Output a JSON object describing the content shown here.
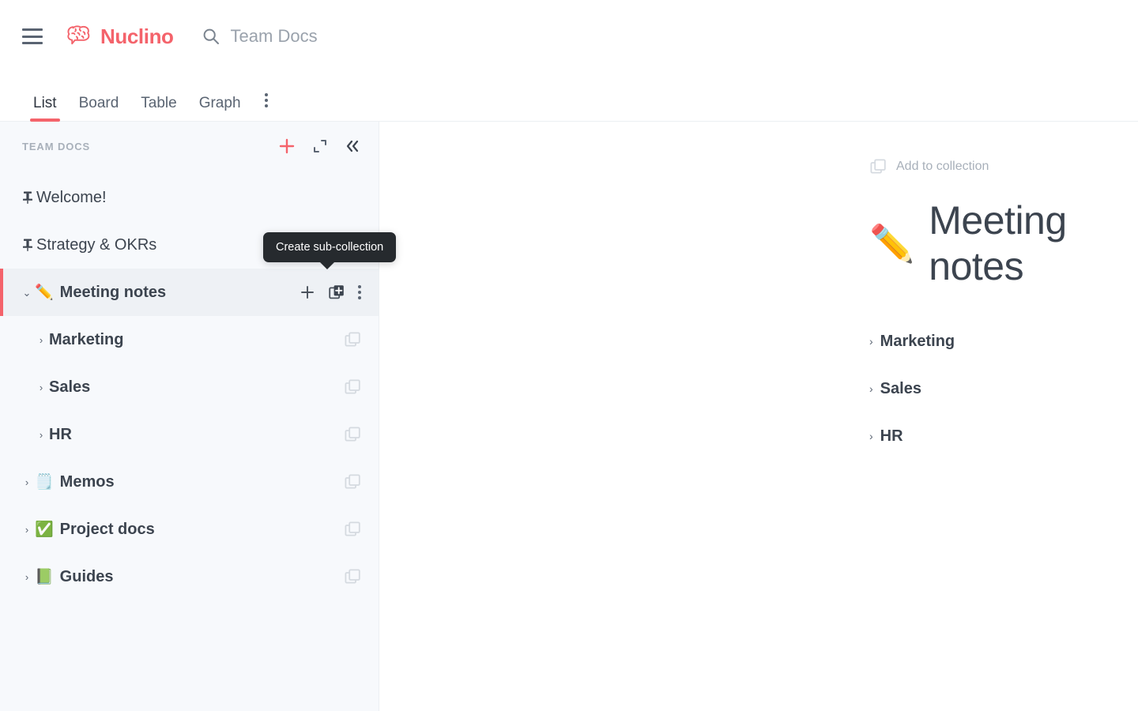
{
  "colors": {
    "brand": "#f4636b",
    "text_dark": "#3c444f",
    "text_muted": "#9aa2ac",
    "sidebar_bg": "#f7f9fc",
    "selected_bg": "#eef1f5",
    "tooltip_bg": "#262a2e"
  },
  "topbar": {
    "menu_icon": "hamburger-menu-icon",
    "brand_name": "Nuclino",
    "brand_logo_icon": "nuclino-brain-logo-icon",
    "search": {
      "icon": "search-icon",
      "value": "Team Docs",
      "placeholder": "Team Docs"
    }
  },
  "tabs": {
    "items": [
      {
        "label": "List",
        "active": true
      },
      {
        "label": "Board",
        "active": false
      },
      {
        "label": "Table",
        "active": false
      },
      {
        "label": "Graph",
        "active": false
      }
    ],
    "more_icon": "more-vertical-icon"
  },
  "sidebar": {
    "title": "TEAM DOCS",
    "actions": [
      {
        "name": "add-item-button",
        "icon": "plus-icon"
      },
      {
        "name": "expand-sidebar-button",
        "icon": "expand-icon"
      },
      {
        "name": "collapse-sidebar-button",
        "icon": "chevrons-left-icon"
      }
    ],
    "items": [
      {
        "label": "Welcome!",
        "icon": "pin-icon",
        "level": 0,
        "kind": "pinned",
        "selected": false,
        "caret": ""
      },
      {
        "label": "Strategy & OKRs",
        "icon": "pin-icon",
        "level": 0,
        "kind": "pinned",
        "selected": false,
        "caret": ""
      },
      {
        "label": "Meeting notes",
        "emoji": "✏️",
        "level": 0,
        "kind": "collection",
        "selected": true,
        "caret": "⌄",
        "expanded": true
      },
      {
        "label": "Marketing",
        "level": 1,
        "kind": "child",
        "selected": false,
        "caret": "›"
      },
      {
        "label": "Sales",
        "level": 1,
        "kind": "child",
        "selected": false,
        "caret": "›"
      },
      {
        "label": "HR",
        "level": 1,
        "kind": "child",
        "selected": false,
        "caret": "›"
      },
      {
        "label": "Memos",
        "emoji": "🗒️",
        "level": 0,
        "kind": "collection",
        "selected": false,
        "caret": "›"
      },
      {
        "label": "Project docs",
        "emoji": "✅",
        "level": 0,
        "kind": "collection",
        "selected": false,
        "caret": "›"
      },
      {
        "label": "Guides",
        "emoji": "📗",
        "level": 0,
        "kind": "collection",
        "selected": false,
        "caret": "›"
      }
    ],
    "selected_row_actions": [
      {
        "name": "create-item-button",
        "icon": "plus-icon"
      },
      {
        "name": "create-sub-collection-button",
        "icon": "add-to-stack-icon",
        "active": true
      },
      {
        "name": "row-more-button",
        "icon": "more-vertical-icon"
      }
    ],
    "tooltip": {
      "text": "Create sub-collection"
    }
  },
  "main": {
    "add_to_collection": {
      "label": "Add to collection",
      "icon": "stack-copy-icon"
    },
    "title_emoji": "✏️",
    "title": "Meeting notes",
    "items": [
      {
        "label": "Marketing",
        "caret": "›"
      },
      {
        "label": "Sales",
        "caret": "›"
      },
      {
        "label": "HR",
        "caret": "›"
      }
    ]
  }
}
